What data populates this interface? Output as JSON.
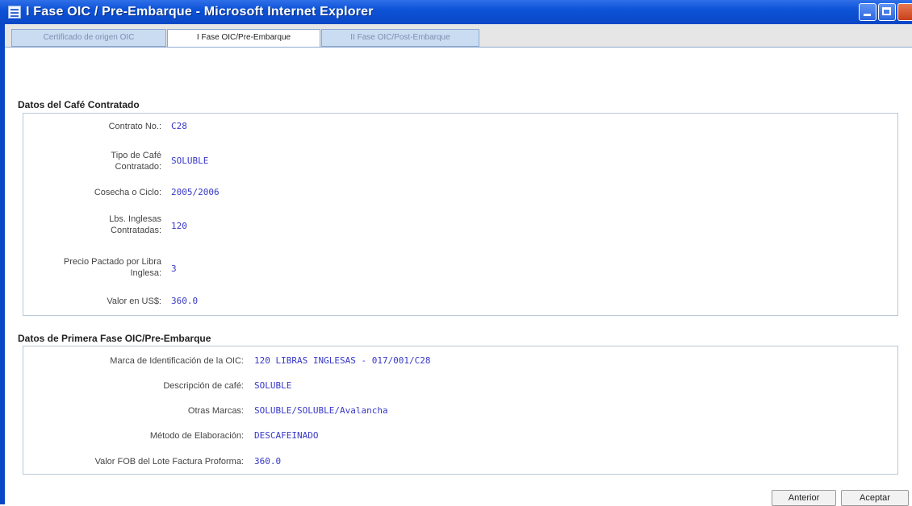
{
  "window": {
    "title": "I Fase OIC / Pre-Embarque - Microsoft Internet Explorer"
  },
  "tabs": [
    {
      "label": "Certificado de origen OIC",
      "active": false
    },
    {
      "label": "I Fase OIC/Pre-Embarque",
      "active": true
    },
    {
      "label": "II Fase OIC/Post-Embarque",
      "active": false
    }
  ],
  "section1": {
    "title": "Datos del Café Contratado",
    "fields": [
      {
        "label": "Contrato No.:",
        "value": "C28"
      },
      {
        "label": "Tipo de Café Contratado:",
        "value": "SOLUBLE"
      },
      {
        "label": "Cosecha o Ciclo:",
        "value": "2005/2006"
      },
      {
        "label": "Lbs. Inglesas Contratadas:",
        "value": "120"
      },
      {
        "label": "Precio Pactado por Libra Inglesa:",
        "value": "3"
      },
      {
        "label": "Valor en US$:",
        "value": "360.0"
      }
    ]
  },
  "section2": {
    "title": "Datos de Primera Fase OIC/Pre-Embarque",
    "fields": [
      {
        "label": "Marca de Identificación de la OIC:",
        "value": "120 LIBRAS INGLESAS - 017/001/C28"
      },
      {
        "label": "Descripción de café:",
        "value": "SOLUBLE"
      },
      {
        "label": "Otras Marcas:",
        "value": "SOLUBLE/SOLUBLE/Avalancha"
      },
      {
        "label": "Método de Elaboración:",
        "value": "DESCAFEINADO"
      },
      {
        "label": "Valor FOB del Lote Factura Proforma:",
        "value": "360.0"
      }
    ]
  },
  "buttons": {
    "previous": "Anterior",
    "accept": "Aceptar"
  },
  "colors": {
    "titlebar": "#0d53d8",
    "value_text": "#3838c8",
    "tab_inactive": "#c9dcf2"
  }
}
